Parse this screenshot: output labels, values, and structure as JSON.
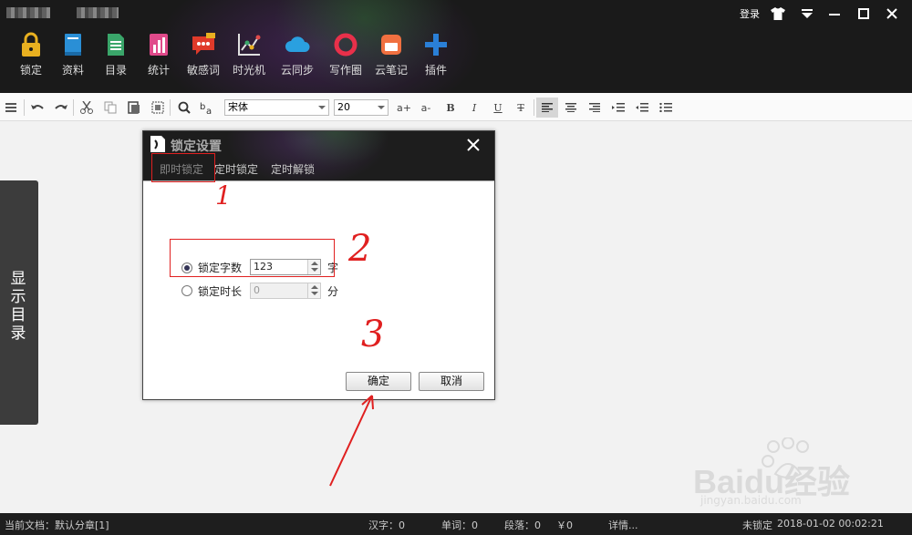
{
  "window": {
    "login_label": "登录",
    "controls": [
      "skin-icon",
      "menu-icon",
      "minimize-icon",
      "maximize-icon",
      "close-icon"
    ]
  },
  "toolbar": {
    "items": [
      {
        "label": "锁定",
        "icon": "lock-icon",
        "color": "#e8b020"
      },
      {
        "label": "资料",
        "icon": "book-icon",
        "color": "#2a8fd6"
      },
      {
        "label": "目录",
        "icon": "document-icon",
        "color": "#3aa66a"
      },
      {
        "label": "统计",
        "icon": "chart-icon",
        "color": "#e04a8a"
      },
      {
        "label": "敏感词",
        "icon": "chat-bubble-icon",
        "color": "#e03a2a"
      },
      {
        "label": "时光机",
        "icon": "line-chart-icon",
        "color": "#e0e0e0"
      },
      {
        "label": "云同步",
        "icon": "cloud-icon",
        "color": "#2aa0e0"
      },
      {
        "label": "写作圈",
        "icon": "ring-icon",
        "color": "#e8304a"
      },
      {
        "label": "云笔记",
        "icon": "note-icon",
        "color": "#f07040"
      },
      {
        "label": "插件",
        "icon": "plus-icon",
        "color": "#2a7fd6"
      }
    ]
  },
  "format_bar": {
    "font": "宋体",
    "size": "20",
    "buttons": [
      "align-icon",
      "undo-icon",
      "redo-icon",
      "cut-icon",
      "copy-icon",
      "paste-icon",
      "select-all-icon",
      "search-icon",
      "replace-icon",
      "font-grow-icon",
      "font-shrink-icon",
      "bold-icon",
      "italic-icon",
      "underline-icon",
      "strikethrough-icon",
      "align-left-icon",
      "align-center-icon",
      "align-right-icon",
      "indent-icon",
      "outdent-icon",
      "list-icon"
    ],
    "font_grow": "a+",
    "font_shrink": "a-",
    "bold": "B",
    "italic": "I",
    "underline": "U",
    "strike": "T"
  },
  "side_tab": {
    "label": "显示目录"
  },
  "dialog": {
    "title": "锁定设置",
    "tabs": [
      "即时锁定",
      "定时锁定",
      "定时解锁"
    ],
    "active_tab": 0,
    "options": [
      {
        "label": "锁定字数",
        "value": "123",
        "unit": "字",
        "selected": true
      },
      {
        "label": "锁定时长",
        "value": "0",
        "unit": "分",
        "selected": false
      }
    ],
    "ok_label": "确定",
    "cancel_label": "取消"
  },
  "annotations": {
    "mark1": "1",
    "mark2": "2",
    "mark3": "3",
    "accent": "#e02020"
  },
  "status_bar": {
    "document": "当前文档：默认分章[1]",
    "chars": "汉字：0",
    "words": "单词：0",
    "paragraphs": "段落：0",
    "money": "￥0",
    "details": "详情...",
    "lock_state": "未锁定",
    "datetime": "2018-01-02 00:02:21"
  },
  "watermark": {
    "brand": "Baidu经验",
    "url": "jingyan.baidu.com"
  }
}
